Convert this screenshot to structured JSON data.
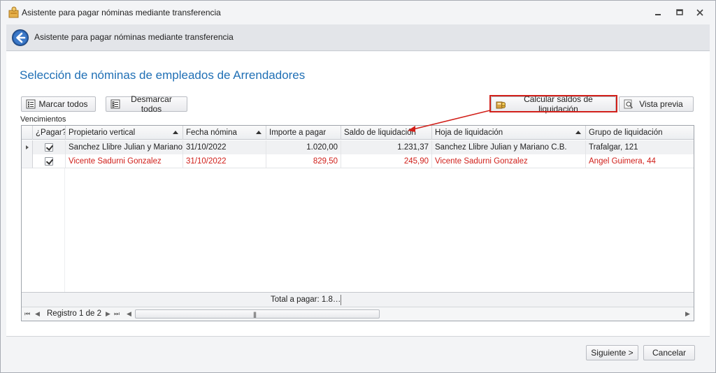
{
  "window": {
    "title": "Asistente para pagar nóminas mediante transferencia",
    "controls": [
      "minimize",
      "restore",
      "close"
    ]
  },
  "header": {
    "title": "Asistente para pagar nóminas mediante transferencia",
    "back_icon": "back-arrow-icon"
  },
  "section_title": "Selección de nóminas de empleados de Arrendadores",
  "toolbar": {
    "mark_all": "Marcar todos",
    "unmark_all": "Desmarcar todos",
    "calculate": "Calcular saldos de liquidación",
    "preview": "Vista previa"
  },
  "grid": {
    "caption": "Vencimientos",
    "columns": [
      "¿Pagar?",
      "Propietario vertical",
      "Fecha nómina",
      "Importe a pagar",
      "Saldo de liquidación",
      "Hoja de  liquidación",
      "Grupo de liquidación"
    ],
    "rows": [
      {
        "pay": true,
        "owner": "Sanchez Llibre Julian y Mariano…",
        "date": "31/10/2022",
        "amount": "1.020,00",
        "balance": "1.231,37",
        "sheet": "Sanchez Llibre Julian y Mariano C.B.",
        "group": "Trafalgar, 121",
        "color": "#222222"
      },
      {
        "pay": true,
        "owner": "Vicente Sadurni Gonzalez",
        "date": "31/10/2022",
        "amount": "829,50",
        "balance": "245,90",
        "sheet": "Vicente Sadurni Gonzalez",
        "group": "Angel Guimera, 44",
        "color": "#d0201b"
      }
    ],
    "total": "Total a pagar: 1.8…",
    "record": "Registro 1 de 2"
  },
  "footer": {
    "next": "Siguiente >",
    "cancel": "Cancelar"
  },
  "colors": {
    "accent_title": "#1f6fb5",
    "highlight": "#d2201a",
    "red_row": "#d0201b"
  }
}
